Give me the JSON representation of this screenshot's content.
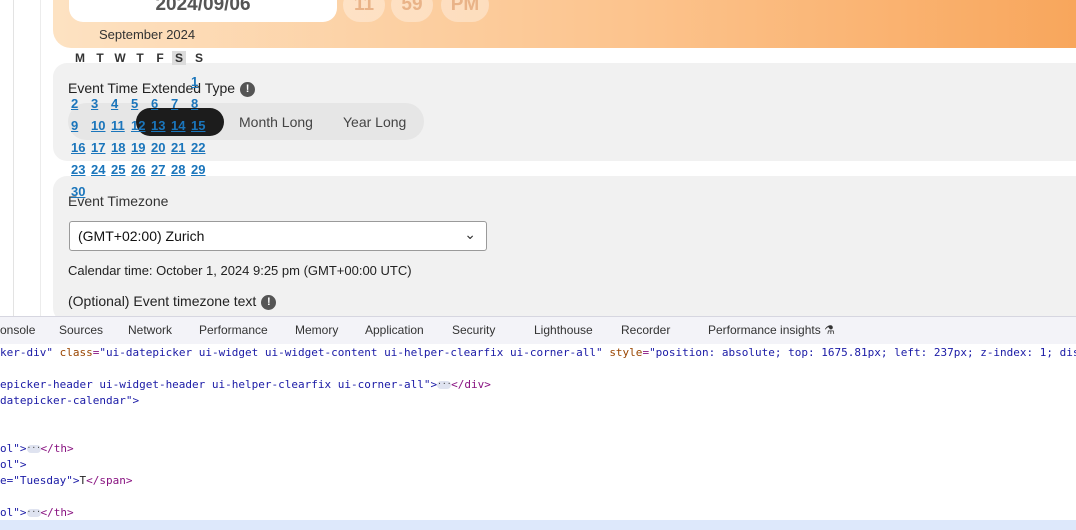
{
  "header": {
    "date_value": "2024/09/06",
    "hour": "11",
    "minute": "59",
    "ampm": "PM",
    "month_label": "September 2024"
  },
  "datepicker": {
    "weekdays": [
      "M",
      "T",
      "W",
      "T",
      "F",
      "S",
      "S"
    ],
    "days": [
      "1",
      "2",
      "3",
      "4",
      "5",
      "6",
      "7",
      "8",
      "9",
      "10",
      "11",
      "12",
      "13",
      "14",
      "15",
      "16",
      "17",
      "18",
      "19",
      "20",
      "21",
      "22",
      "23",
      "24",
      "25",
      "26",
      "27",
      "28",
      "29",
      "30"
    ]
  },
  "event_type": {
    "label": "Event Time Extended Type",
    "info_icon": "!",
    "options": [
      "Month Long",
      "Year Long"
    ]
  },
  "timezone": {
    "label": "Event Timezone",
    "selected": "(GMT+02:00) Zurich",
    "calendar_time": "Calendar time: October 1, 2024 9:25 pm (GMT+00:00 UTC)",
    "optional_label": "(Optional) Event timezone text",
    "info_icon": "!"
  },
  "devtools": {
    "tabs": [
      "onsole",
      "Sources",
      "Network",
      "Performance",
      "Memory",
      "Application",
      "Security",
      "Lighthouse",
      "Recorder",
      "Performance insights"
    ],
    "code": {
      "l1_a": "ker-div\"",
      "l1_b": "class",
      "l1_c": "\"ui-datepicker ui-widget ui-widget-content ui-helper-clearfix ui-corner-all\"",
      "l1_d": "style",
      "l1_e": "\"position: absolute; top: 1675.81px; left: 237px; z-index: 1; dis",
      "l2_a": "epicker-header ui-widget-header ui-helper-clearfix ui-corner-all\">",
      "l2_b": "</div>",
      "l3": "datepicker-calendar\">",
      "l4_a": "ol\">",
      "l4_b": "</th>",
      "l5": "ol\">",
      "l6_a": "e=\"Tuesday\">",
      "l6_b": "T",
      "l6_c": "</span>",
      "l7_a": "ol\">",
      "l7_b": "</th>"
    }
  }
}
